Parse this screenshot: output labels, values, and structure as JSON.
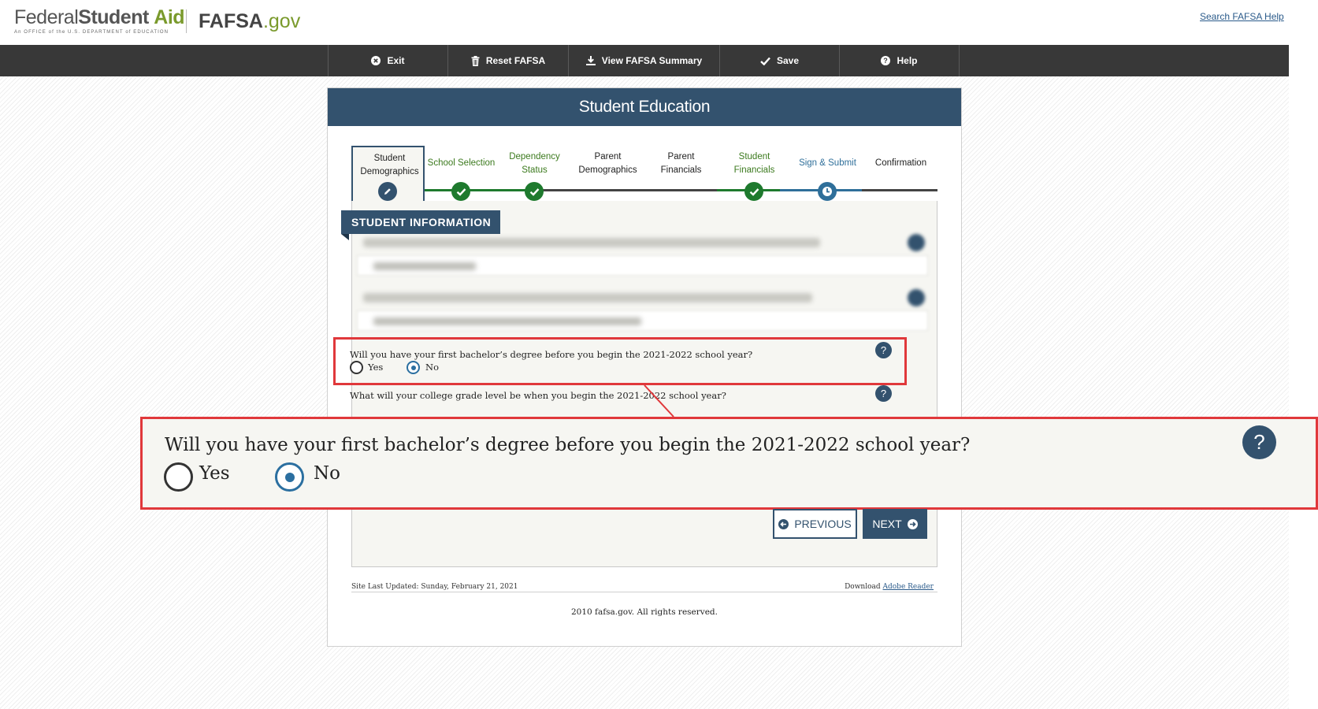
{
  "header": {
    "fsa_word1": "Federal",
    "fsa_word2": "Student",
    "fsa_word3": "Aid",
    "fsa_tagline": "An OFFICE of the U.S. DEPARTMENT of EDUCATION",
    "fafsa_logo": "FAFSA",
    "fafsa_logo_suffix": ".gov",
    "search_help_link": "Search FAFSA Help"
  },
  "nav": {
    "items": [
      {
        "label": "Exit",
        "icon": "close-circle-icon"
      },
      {
        "label": "Reset FAFSA",
        "icon": "trash-icon"
      },
      {
        "label": "View FAFSA Summary",
        "icon": "download-icon"
      },
      {
        "label": "Save",
        "icon": "checkmark-icon"
      },
      {
        "label": "Help",
        "icon": "question-circle-icon"
      }
    ]
  },
  "panel": {
    "title": "Student Education"
  },
  "steps": [
    {
      "line1": "Student",
      "line2": "Demographics",
      "state": "active",
      "icon": "pencil-icon"
    },
    {
      "line1": "School Selection",
      "line2": "",
      "state": "complete",
      "icon": "checkmark-icon"
    },
    {
      "line1": "Dependency",
      "line2": "Status",
      "state": "complete",
      "icon": "checkmark-icon"
    },
    {
      "line1": "Parent",
      "line2": "Demographics",
      "state": "pending",
      "icon": ""
    },
    {
      "line1": "Parent",
      "line2": "Financials",
      "state": "pending",
      "icon": ""
    },
    {
      "line1": "Student",
      "line2": "Financials",
      "state": "complete",
      "icon": "checkmark-icon"
    },
    {
      "line1": "Sign & Submit",
      "line2": "",
      "state": "in-progress",
      "icon": "clock-icon"
    },
    {
      "line1": "Confirmation",
      "line2": "",
      "state": "pending",
      "icon": ""
    }
  ],
  "section": {
    "title": "STUDENT INFORMATION"
  },
  "questions": {
    "bachelors": {
      "text": "Will you have your first bachelor’s degree before you begin the 2021-2022 school year?",
      "options": [
        "Yes",
        "No"
      ],
      "selected": "No"
    },
    "grade_level": {
      "text": "What will your college grade level be when you begin the 2021-2022 school year?"
    },
    "help_glyph": "?"
  },
  "buttons": {
    "previous": "PREVIOUS",
    "next": "NEXT"
  },
  "footer": {
    "last_updated": "Site Last Updated: Sunday, February 21, 2021",
    "download_prefix": "Download",
    "download_link": "Adobe Reader",
    "copyright": "2010 fafsa.gov. All rights reserved."
  },
  "colors": {
    "brand_navy": "#33526e",
    "brand_green": "#7a9a2c",
    "step_complete": "#1e7a2e",
    "highlight_red": "#e0383b",
    "nav_bg": "#383838"
  }
}
